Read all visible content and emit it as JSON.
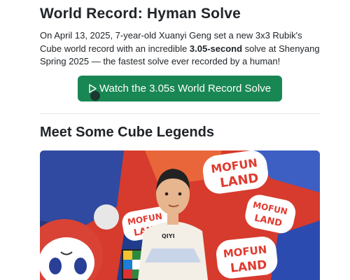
{
  "heading": "World Record: Hyman Solve",
  "intro": {
    "before": "On April 13, 2025, 7-year-old Xuanyi Geng set a new 3x3 Rubik's Cube world record with an incredible ",
    "bold": "3.05-second",
    "after": " solve at Shenyang Spring 2025 — the fastest solve ever recorded by a human!"
  },
  "watch_button": {
    "label": "Watch the 3.05s World Record Solve",
    "icon": "play-icon",
    "color": "#198754"
  },
  "section_heading": "Meet Some Cube Legends",
  "photo": {
    "icon": "photo-of-child-with-cube",
    "backdrop_text": [
      "MOFUN",
      "LAND"
    ],
    "shirt_text": "QIYI"
  },
  "colors": {
    "accent_green": "#198754",
    "text": "#212529",
    "divider": "#e5e7eb"
  }
}
